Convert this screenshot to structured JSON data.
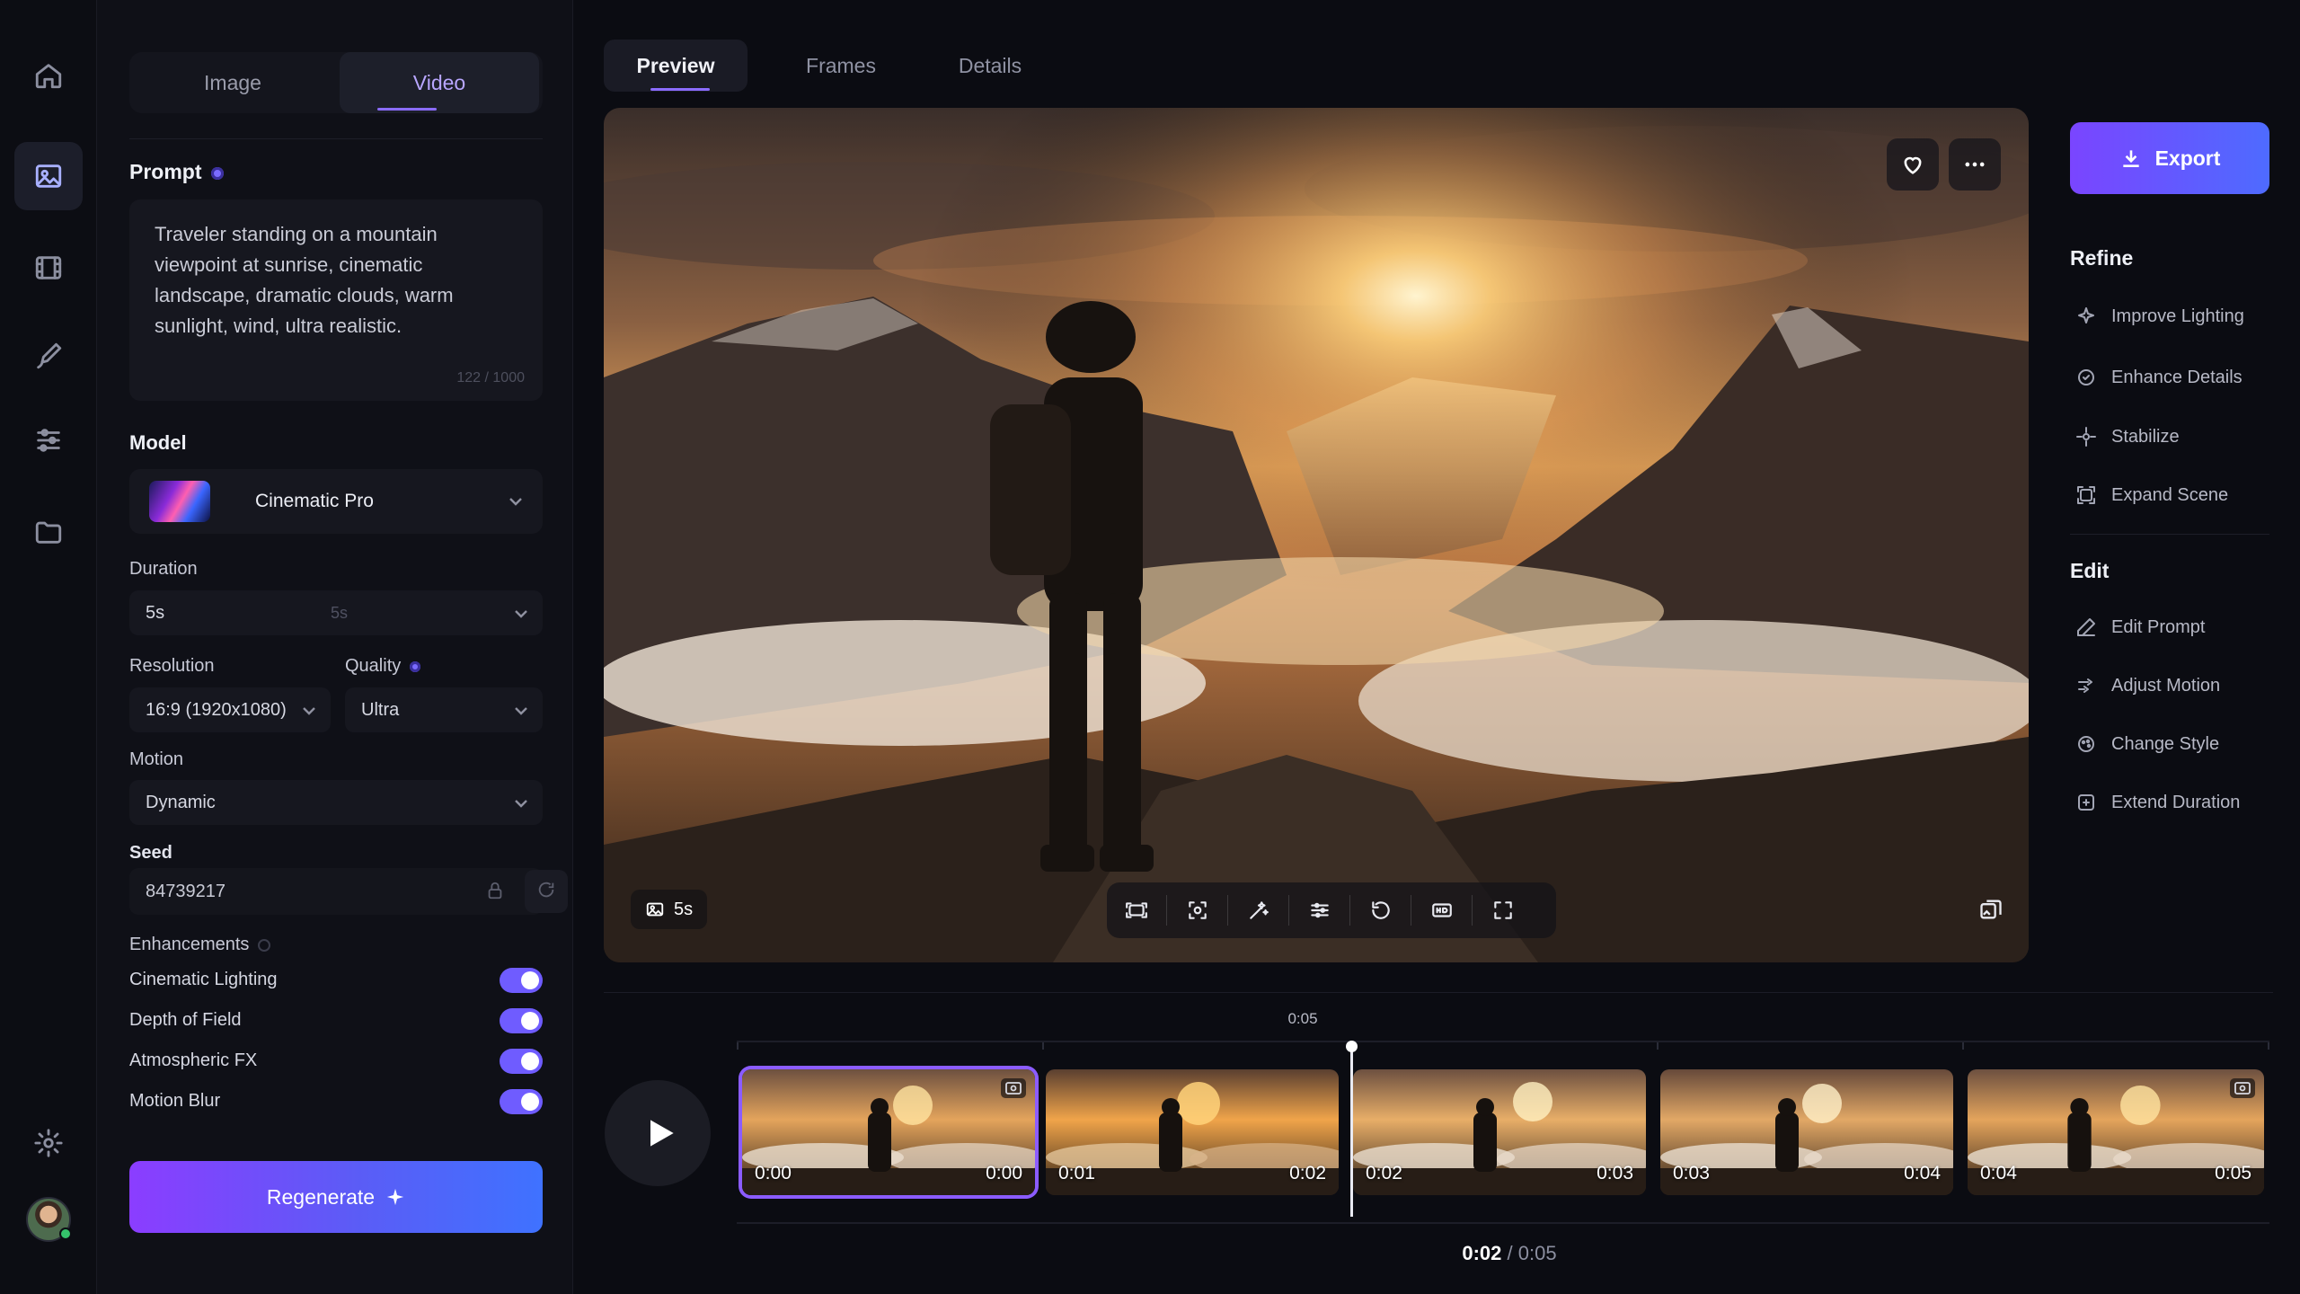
{
  "left_panel": {
    "tabs": {
      "image": "Image",
      "video": "Video"
    },
    "prompt": {
      "label": "Prompt",
      "text": "Traveler standing on a mountain viewpoint at sunrise, cinematic landscape, dramatic clouds, warm sunlight, wind, ultra realistic.",
      "count": "122 / 1000"
    },
    "model": {
      "label": "Model",
      "value": "Cinematic Pro"
    },
    "duration": {
      "label": "Duration",
      "value": "5s",
      "ghost": "5s"
    },
    "resolution": {
      "label": "Resolution",
      "value": "16:9 (1920x1080)"
    },
    "quality": {
      "label": "Quality",
      "value": "Ultra"
    },
    "motion": {
      "label": "Motion",
      "value": "Dynamic"
    },
    "seed": {
      "label": "Seed",
      "value": "84739217"
    },
    "enhancements": {
      "label": "Enhancements",
      "items": [
        {
          "label": "Cinematic Lighting",
          "on": true
        },
        {
          "label": "Depth of Field",
          "on": true
        },
        {
          "label": "Atmospheric FX",
          "on": true
        },
        {
          "label": "Motion Blur",
          "on": true
        }
      ]
    },
    "regenerate_label": "Regenerate"
  },
  "center": {
    "tabs": {
      "preview": "Preview",
      "frames": "Frames",
      "details": "Details"
    },
    "duration_chip": "5s",
    "scrub_time": "0:05",
    "frames": [
      {
        "start": "0:00",
        "end": "0:00",
        "selected": true
      },
      {
        "start": "0:01",
        "end": "0:02",
        "selected": false
      },
      {
        "start": "0:02",
        "end": "0:03",
        "selected": false
      },
      {
        "start": "0:03",
        "end": "0:04",
        "selected": false
      },
      {
        "start": "0:04",
        "end": "0:05",
        "selected": false
      }
    ],
    "timecode": {
      "current": "0:02",
      "total": "0:05",
      "separator": "/"
    }
  },
  "right_panel": {
    "export_label": "Export",
    "refine": {
      "heading": "Refine",
      "items": [
        {
          "label": "Improve Lighting",
          "icon": "sparkle-icon"
        },
        {
          "label": "Enhance Details",
          "icon": "enhance-icon"
        },
        {
          "label": "Stabilize",
          "icon": "stabilize-icon"
        },
        {
          "label": "Expand Scene",
          "icon": "expand-icon"
        }
      ]
    },
    "edit": {
      "heading": "Edit",
      "items": [
        {
          "label": "Edit Prompt",
          "icon": "pencil-icon"
        },
        {
          "label": "Adjust Motion",
          "icon": "motion-icon"
        },
        {
          "label": "Change Style",
          "icon": "style-icon"
        },
        {
          "label": "Extend Duration",
          "icon": "extend-icon"
        }
      ]
    }
  },
  "colors": {
    "accent": "#8b5cff",
    "accent_blue": "#4e6bff",
    "background": "#0b0c12",
    "panel": "#0f1017"
  }
}
